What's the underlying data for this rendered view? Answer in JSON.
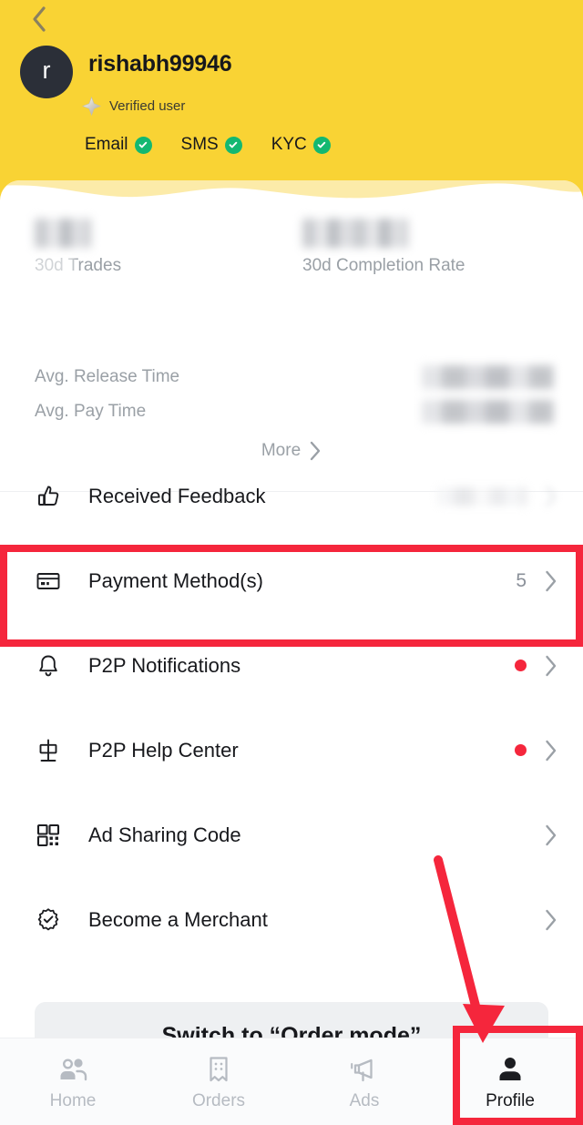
{
  "header": {
    "back_icon": "chevron-left-icon",
    "avatar_initial": "r",
    "username": "rishabh99946",
    "badge_icon": "diamond-badge-icon",
    "verified_text": "Verified user",
    "verifications": [
      {
        "label": "Email",
        "verified": true
      },
      {
        "label": "SMS",
        "verified": true
      },
      {
        "label": "KYC",
        "verified": true
      }
    ],
    "background_color": "#F9D334"
  },
  "stats": {
    "trades": {
      "value": "",
      "value_redacted": true,
      "label": "30d Trades"
    },
    "completion": {
      "value": "",
      "value_redacted": true,
      "label": "30d Completion Rate"
    },
    "rows": [
      {
        "label": "Avg. Release Time",
        "value": "",
        "value_redacted": true
      },
      {
        "label": "Avg. Pay Time",
        "value": "",
        "value_redacted": true
      }
    ],
    "more_label": "More",
    "more_icon": "chevron-right-icon"
  },
  "menu": {
    "items": [
      {
        "icon": "thumbs-up-icon",
        "label": "Received Feedback",
        "value": "",
        "value_redacted": true,
        "dot": false,
        "chevron": "chevron-right-icon"
      },
      {
        "icon": "card-icon",
        "label": "Payment Method(s)",
        "value": "5",
        "value_redacted": false,
        "dot": false,
        "chevron": "chevron-right-icon",
        "highlighted": true
      },
      {
        "icon": "bell-icon",
        "label": "P2P Notifications",
        "value": "",
        "value_redacted": false,
        "dot": true,
        "chevron": "chevron-right-icon"
      },
      {
        "icon": "help-signpost-icon",
        "label": "P2P Help Center",
        "value": "",
        "value_redacted": false,
        "dot": true,
        "chevron": "chevron-right-icon"
      },
      {
        "icon": "qr-code-icon",
        "label": "Ad Sharing Code",
        "value": "",
        "value_redacted": false,
        "dot": false,
        "chevron": "chevron-right-icon"
      },
      {
        "icon": "merchant-seal-icon",
        "label": "Become a Merchant",
        "value": "",
        "value_redacted": false,
        "dot": false,
        "chevron": "chevron-right-icon"
      }
    ]
  },
  "order_banner": {
    "label": "Switch to “Order mode”"
  },
  "bottom_nav": {
    "items": [
      {
        "icon": "people-icon",
        "label": "Home",
        "active": false
      },
      {
        "icon": "orders-icon",
        "label": "Orders",
        "active": false
      },
      {
        "icon": "megaphone-icon",
        "label": "Ads",
        "active": false
      },
      {
        "icon": "person-icon",
        "label": "Profile",
        "active": true
      }
    ]
  },
  "annotations": {
    "highlight_color": "#F5263C",
    "payment_box": "Payment Method(s) row highlighted",
    "profile_box": "Profile tab highlighted",
    "arrow": "arrow pointing to Profile tab"
  }
}
